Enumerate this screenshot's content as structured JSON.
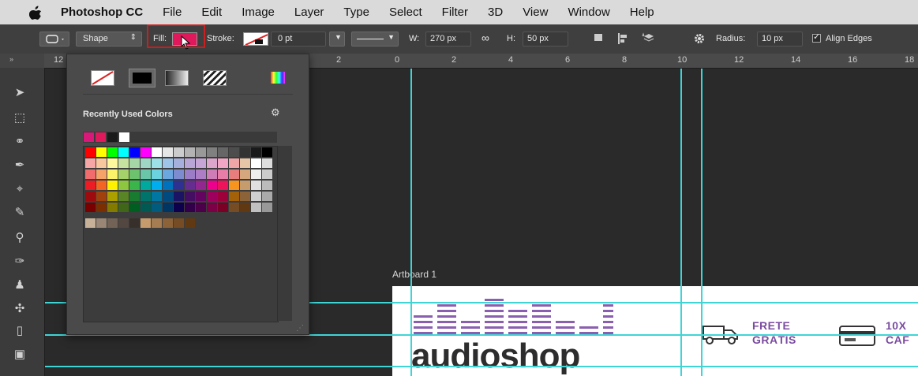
{
  "menubar": {
    "app_name": "Photoshop CC",
    "items": [
      "File",
      "Edit",
      "Image",
      "Layer",
      "Type",
      "Select",
      "Filter",
      "3D",
      "View",
      "Window",
      "Help"
    ]
  },
  "options": {
    "mode_label": "Shape",
    "fill_label": "Fill:",
    "fill_color": "#e0195c",
    "stroke_label": "Stroke:",
    "stroke_width": "0 pt",
    "w_label": "W:",
    "w_value": "270 px",
    "h_label": "H:",
    "h_value": "50 px",
    "radius_label": "Radius:",
    "radius_value": "10 px",
    "align_edges_label": "Align Edges",
    "align_edges_checked": true
  },
  "ruler": {
    "corner": "12",
    "labels": [
      "2",
      "0",
      "2",
      "4",
      "6",
      "8",
      "10",
      "12",
      "14",
      "16",
      "18"
    ]
  },
  "panel": {
    "recent_title": "Recently Used Colors",
    "recent_colors": [
      "#d8197a",
      "#e0195c",
      "#1a1a1a",
      "#ffffff"
    ],
    "highlight_color": "#cc1f1f"
  },
  "artboard": {
    "label": "Artboard 1",
    "logo_text": "audioshop",
    "frete_line1": "FRETE",
    "frete_line2": "GRÁTIS",
    "promo_line1": "10X",
    "promo_line2": "CAF"
  },
  "colors": {
    "guide": "#3fd5d5",
    "accent_purple": "#7a4ba0"
  }
}
